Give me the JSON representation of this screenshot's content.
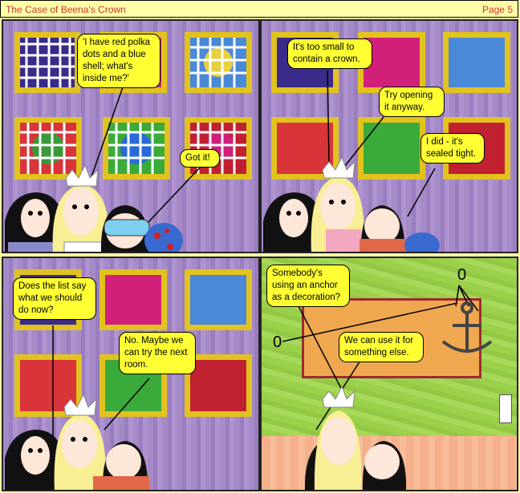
{
  "header": {
    "title": "The Case of Beena's Crown",
    "page": "Page 5"
  },
  "panels": {
    "p1": {
      "bubble1": "'I have red polka dots and a blue shell; what's inside me?'",
      "bubble2": "Got it!"
    },
    "p2": {
      "bubble1": "It's too small to contain a crown.",
      "bubble2": "Try opening it anyway.",
      "bubble3": "I did - it's sealed tight."
    },
    "p3": {
      "bubble1": "Does the list say what we should do now?",
      "bubble2": "No. Maybe we can try the next room."
    },
    "p4": {
      "bubble1": "Somebody's using an anchor as a decoration?",
      "bubble2": "We can use it for something else.",
      "label_left": "0",
      "label_right": "0"
    }
  },
  "colors": {
    "bubble": "#ffff33",
    "frame": "#e2c21e",
    "wall": "#a58ac8",
    "accent_title": "#cc3333"
  }
}
